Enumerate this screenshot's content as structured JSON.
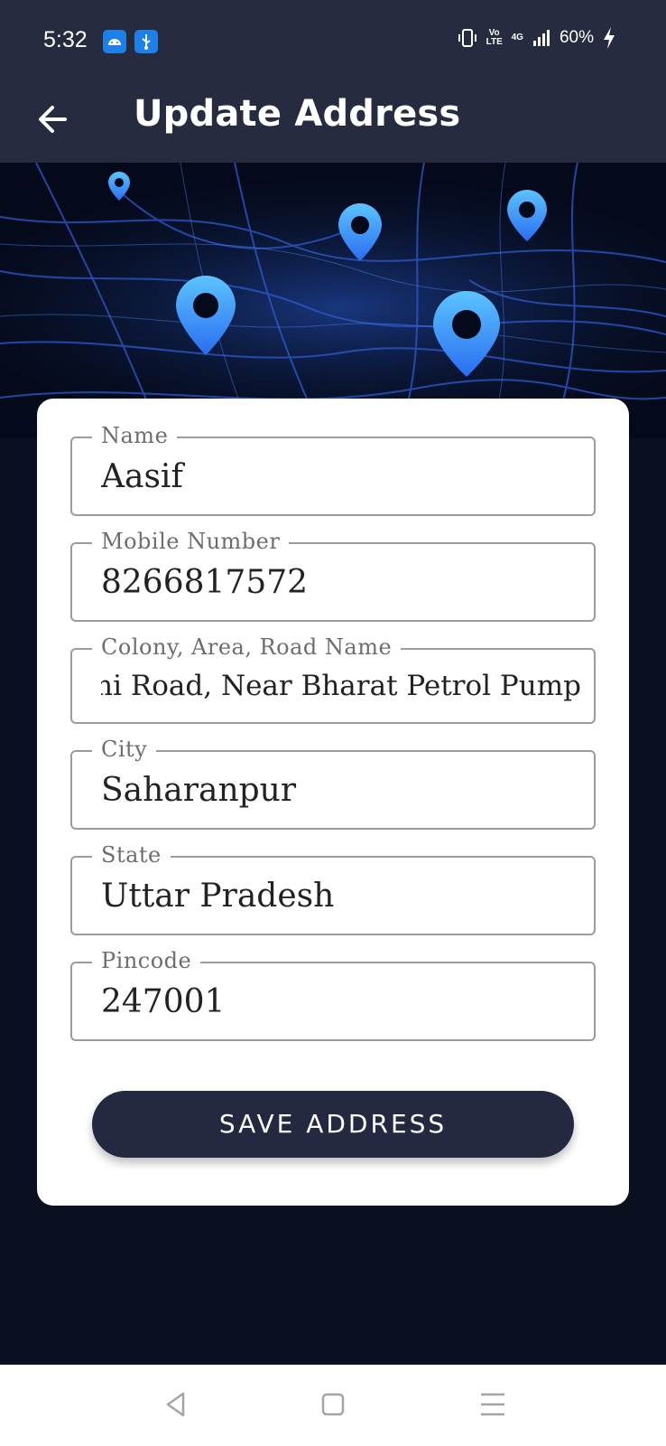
{
  "status_bar": {
    "time": "5:32",
    "icons": [
      "android-icon",
      "usb-icon"
    ],
    "volte": "Vo LTE",
    "network": "4G",
    "battery": "60%"
  },
  "app_bar": {
    "title": "Update Address",
    "back_icon": "back-arrow-icon"
  },
  "form": {
    "fields": [
      {
        "label": "Name",
        "value": "Aasif"
      },
      {
        "label": "Mobile Number",
        "value": "8266817572"
      },
      {
        "label": "Colony, Area, Road Name",
        "value": "elhi Road, Near Bharat Petrol Pump"
      },
      {
        "label": "City",
        "value": "Saharanpur"
      },
      {
        "label": "State",
        "value": "Uttar Pradesh"
      },
      {
        "label": "Pincode",
        "value": "247001"
      }
    ],
    "save_label": "SAVE ADDRESS"
  },
  "colors": {
    "app_bar": "#272b3f",
    "background": "#0b1020",
    "button": "#242840",
    "pin": "#3aa0ff"
  },
  "nav_bar": {
    "icons": [
      "nav-back-icon",
      "nav-home-icon",
      "nav-recents-icon"
    ]
  }
}
